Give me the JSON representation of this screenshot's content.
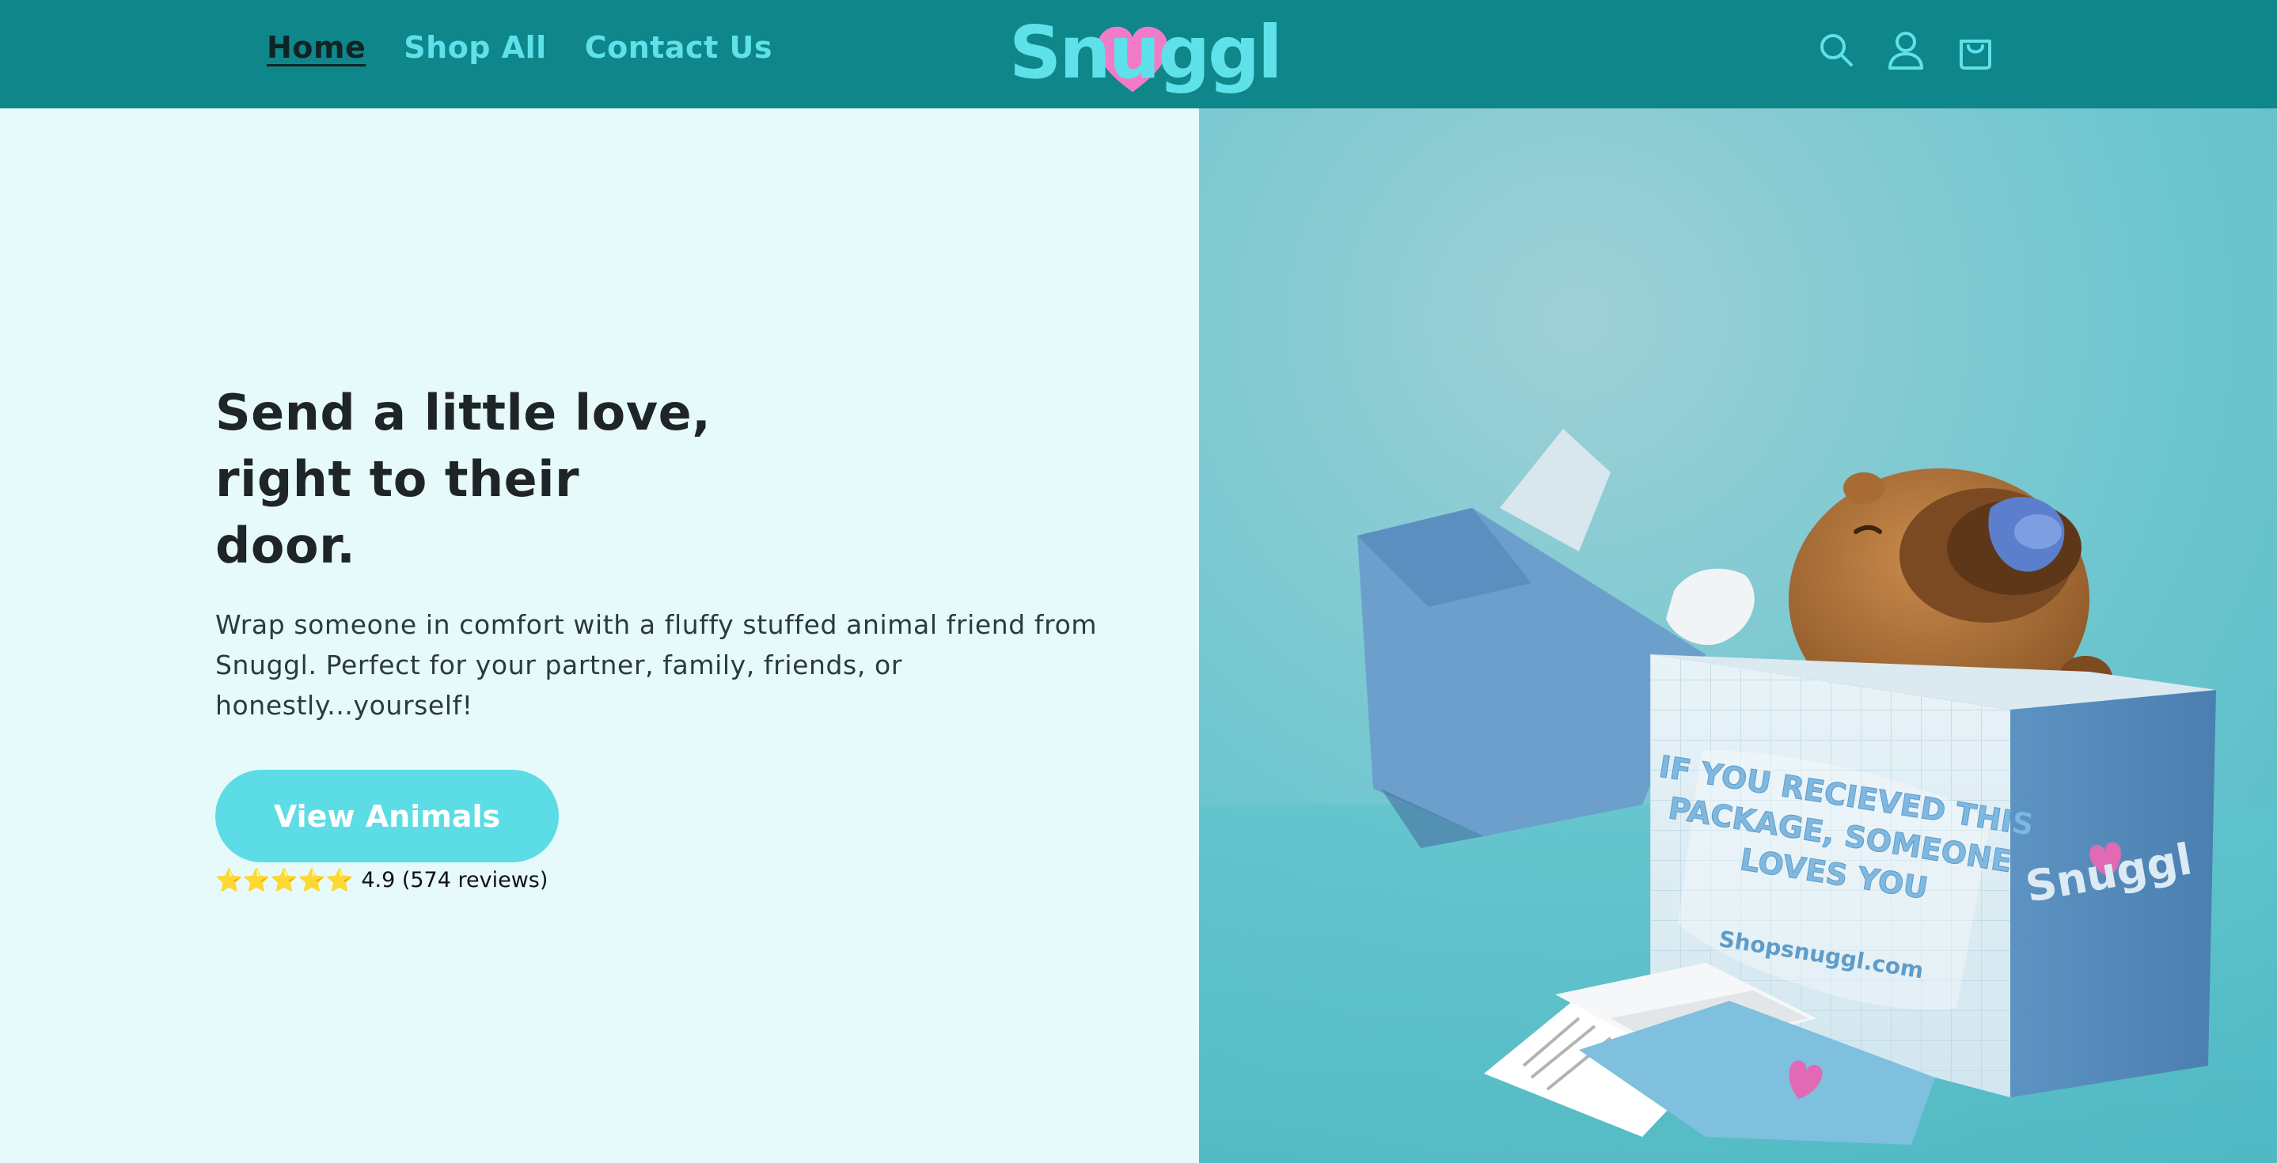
{
  "header": {
    "nav": [
      {
        "label": "Home",
        "active": true
      },
      {
        "label": "Shop All",
        "active": false
      },
      {
        "label": "Contact Us",
        "active": false
      }
    ],
    "logo_text": "Snuggl",
    "icons": [
      "search-icon",
      "account-icon",
      "cart-icon"
    ]
  },
  "hero": {
    "title_line1": "Send a little love,",
    "title_line2": "right to their",
    "title_line3": "door.",
    "subtitle": "Wrap someone in comfort with a fluffy stuffed animal friend from Snuggl. Perfect for your partner, family, friends, or honestly...yourself!",
    "cta_label": "View Animals",
    "stars": "⭐⭐⭐⭐⭐",
    "rating_text": "4.9 (574 reviews)"
  },
  "image": {
    "box_text": "IF YOU RECIEVED THIS PACKAGE, SOMEONE LOVES YOU",
    "box_url": "Shopsnuggl.com",
    "box_logo": "Snuggl"
  },
  "colors": {
    "header_bg": "#0f868a",
    "nav_text": "#5fe1ea",
    "nav_active": "#102426",
    "hero_bg": "#e7fafb",
    "cta_bg": "#5cdde6",
    "heart": "#f27bc8",
    "photo_bg": "#5bbfc9"
  }
}
